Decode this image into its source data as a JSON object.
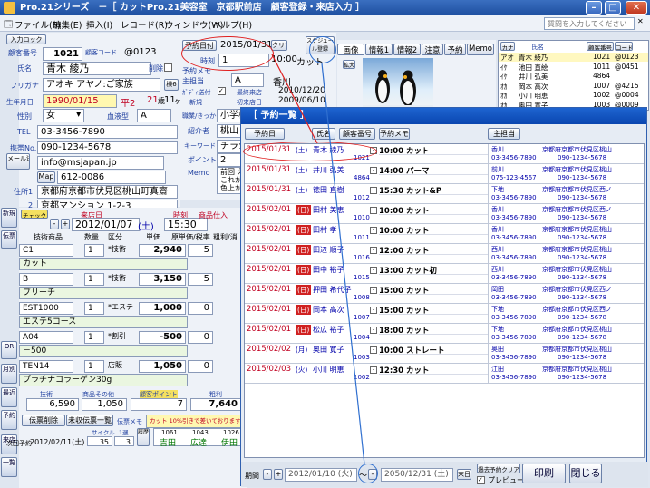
{
  "window": {
    "title": "Pro.21シリーズ　－［ カットPro.21美容室　京都駅前店　顧客登録・来店入力 ］"
  },
  "menu": {
    "items": [
      "ファイル(F)",
      "編集(E)",
      "挿入(I)",
      "レコード(R)",
      "ウィンドウ(W)",
      "ヘルプ(H)"
    ],
    "question_placeholder": "質問を入力してください"
  },
  "sidebar": {
    "buttons": [
      "新規",
      "伝票",
      "OR",
      "月別",
      "最近",
      "予約",
      "来店",
      "一覧"
    ]
  },
  "customer": {
    "intake_btn": "入力ロック",
    "no_label": "顧客番号",
    "no": "1021",
    "code_label": "顧客コード",
    "code": "@0123",
    "name_label": "氏名",
    "name": "青木 綾乃",
    "delete_label": "削除",
    "furigana_label": "フリガナ",
    "furigana": "アオキ アヤノ:ご家族",
    "suffix": "様6",
    "birth_label": "生年月日",
    "birth": "1990/01/15",
    "era": "平2",
    "age": "21",
    "age_unit": "歳",
    "month": "11",
    "month_unit": "ヶ月",
    "gender_label": "性別",
    "gender": "女",
    "blood_label": "血液型",
    "blood": "A",
    "tel_label": "TEL",
    "tel": "03-3456-7890",
    "mobile_label": "携帯No.",
    "mobile": "090-1234-5678",
    "mail_label": "メール送信",
    "mail": "info@msjapan.jp",
    "map_btn": "Map",
    "zip": "612-0086",
    "addr_label": "住所1",
    "addr1": "京都府京都市伏見区桃山町真齋",
    "addr2_label": "2",
    "addr2": "京都マンション 1-2-3"
  },
  "reserve": {
    "date_btn": "予約日付",
    "date": "2015/01/31",
    "clear": "クリア",
    "time_label": "時刻",
    "hour": "1",
    "min": "",
    "time": "10:00",
    "menu": "カット",
    "memo_label": "予約メモ",
    "staff_label": "主担当",
    "staff": "A",
    "staff_name": "香川",
    "send_label": "ｶﾞﾃﾞｨ送付",
    "first_label": "最終来店",
    "first": "2010/12/20",
    "new_label": "新規",
    "register_label": "初来店日",
    "register": "2009/06/10",
    "intro_label": "紹介者",
    "occupation_label": "職業/きっかけ",
    "occupation": "小学校",
    "store_label": "桃山",
    "keyword_label": "キーワード",
    "keyword": "チラシ",
    "point_label": "ポイント",
    "point": "2",
    "memo_label2": "Memo",
    "memo_text": "前回 え これが 色上が"
  },
  "tabs": [
    "画像",
    "情報1",
    "情報2",
    "注意",
    "予約",
    "Memo"
  ],
  "right_list": {
    "header": [
      "カナ",
      "氏名",
      "顧客番号",
      "コード"
    ],
    "rows": [
      {
        "k": "アオ",
        "n": "青木 綾乃",
        "no": "1021",
        "c": "@0123"
      },
      {
        "k": "ｲｹ",
        "n": "池田 直絵",
        "no": "1011",
        "c": "@0451"
      },
      {
        "k": "ｲｹ",
        "n": "井川 弘美",
        "no": "4864",
        "c": ""
      },
      {
        "k": "ｵｶ",
        "n": "岡本 高次",
        "no": "1007",
        "c": "@4215"
      },
      {
        "k": "ｵｶ",
        "n": "小川 明恵",
        "no": "1002",
        "c": "@0004"
      },
      {
        "k": "ｵｶ",
        "n": "奥田 寛子",
        "no": "1003",
        "c": "@0009"
      }
    ]
  },
  "visit": {
    "label": "来店日",
    "date": "2012/01/07",
    "dow": "(土)",
    "time_label": "時刻",
    "time": "15:30",
    "slip_label": "商品仕入",
    "cols": [
      "技術商品",
      "数量",
      "区分",
      "単価",
      "原単価/税率",
      "粗利/消"
    ],
    "rows": [
      {
        "code": "C1",
        "qty": "1",
        "kind": "*技術",
        "price": "2,940",
        "rate": "5",
        "name": "カット"
      },
      {
        "code": "B",
        "qty": "1",
        "kind": "*技術",
        "price": "3,150",
        "rate": "5",
        "name": "ブリーチ"
      },
      {
        "code": "EST1000",
        "qty": "1",
        "kind": "*エステ",
        "price": "1,000",
        "rate": "0",
        "name": "エステ5コース"
      },
      {
        "code": "A04",
        "qty": "1",
        "kind": "*割引",
        "price": "-500",
        "rate": "0",
        "name": "－500"
      },
      {
        "code": "TEN14",
        "qty": "1",
        "kind": "店販",
        "price": "1,050",
        "rate": "0",
        "name": "プラチナコラーゲン30g"
      }
    ],
    "sum_tech_label": "技術",
    "sum_tech": "6,590",
    "sum_goods_label": "商品その他",
    "sum_goods": "1,050",
    "sum_point_label": "顧客ポイント",
    "sum_point": "7",
    "sum_gross_label": "粗利",
    "sum_gross": "7,640",
    "slip_del": "伝票削除",
    "unpaid": "未収伝票一覧",
    "slip_memo": "伝票メモ",
    "slip_memo_text": "カット 10%引きで差いております",
    "next_label": "次回予約",
    "next": "2012/02/11(土)",
    "cycle": "サイクル",
    "cycle_val": "35",
    "week": "1週",
    "week_val": "3",
    "foot_staff": [
      "1061",
      "1043",
      "1026"
    ],
    "foot_names": [
      "吉田",
      "広達",
      "伊田"
    ],
    "history_label": "履歴"
  },
  "dialog": {
    "title": "［ 予約一覧 ］",
    "headers": [
      "予約日",
      "氏名",
      "顧客番号",
      "予約メモ",
      "主担当"
    ],
    "rows": [
      {
        "d": "2015/01/31",
        "w": "(土)",
        "red": false,
        "n": "青木 綾乃",
        "id": "1021",
        "t": "10:00 カット",
        "s": "香川",
        "ad": "京都府京都市伏見区桃山",
        "t1": "03-3456-7890",
        "t2": "090-1234-5678"
      },
      {
        "d": "2015/01/31",
        "w": "(土)",
        "red": false,
        "n": "井川 弘美",
        "id": "4864",
        "t": "14:00 パーマ",
        "s": "前川",
        "ad": "京都府京都市伏見区桃山",
        "t1": "075-123-4567",
        "t2": "090-1234-5678"
      },
      {
        "d": "2015/01/31",
        "w": "(土)",
        "red": false,
        "n": "徳田 直樹",
        "id": "1012",
        "t": "15:30 カット&P",
        "s": "下地",
        "ad": "京都府京都市伏見区西ノ",
        "t1": "03-3456-7890",
        "t2": "090-1234-5678"
      },
      {
        "d": "2015/02/01",
        "w": "(日)",
        "red": true,
        "n": "田村 美恵",
        "id": "1010",
        "t": "10:00 カット",
        "s": "香川",
        "ad": "京都府京都市伏見区西ノ",
        "t1": "03-3456-7890",
        "t2": "090-1234-5678"
      },
      {
        "d": "2015/02/01",
        "w": "(日)",
        "red": true,
        "n": "田村 孝",
        "id": "1011",
        "t": "10:00 カット",
        "s": "香川",
        "ad": "京都府京都市伏見区桃山",
        "t1": "03-3456-7890",
        "t2": "090-1234-5678"
      },
      {
        "d": "2015/02/01",
        "w": "(日)",
        "red": true,
        "n": "田辺 順子",
        "id": "1016",
        "t": "12:00 カット",
        "s": "西川",
        "ad": "京都府京都市伏見区桃山",
        "t1": "03-3456-7890",
        "t2": "090-1234-5678"
      },
      {
        "d": "2015/02/01",
        "w": "(日)",
        "red": true,
        "n": "田中 裕子",
        "id": "1015",
        "t": "13:00 カット初",
        "s": "西川",
        "ad": "京都府京都市伏見区桃山",
        "t1": "03-3456-7890",
        "t2": "090-1234-5678"
      },
      {
        "d": "2015/02/01",
        "w": "(日)",
        "red": true,
        "n": "押田 希代子",
        "id": "1008",
        "t": "15:00 カット",
        "s": "岡田",
        "ad": "京都府京都市伏見区西ノ",
        "t1": "03-3456-7890",
        "t2": "090-1234-5678"
      },
      {
        "d": "2015/02/01",
        "w": "(日)",
        "red": true,
        "n": "岡本 高次",
        "id": "1007",
        "t": "15:00 カット",
        "s": "下地",
        "ad": "京都府京都市伏見区西ノ",
        "t1": "03-3456-7890",
        "t2": "090-1234-5678"
      },
      {
        "d": "2015/02/01",
        "w": "(日)",
        "red": true,
        "n": "松広 裕子",
        "id": "1004",
        "t": "18:00 カット",
        "s": "下地",
        "ad": "京都府京都市伏見区桃山",
        "t1": "03-3456-7890",
        "t2": "090-1234-5678"
      },
      {
        "d": "2015/02/02",
        "w": "(月)",
        "red": false,
        "n": "奥田 寛子",
        "id": "1003",
        "t": "10:00 ストレート",
        "s": "奥田",
        "ad": "京都府京都市伏見区桃山",
        "t1": "03-3456-7890",
        "t2": "090-1234-5678"
      },
      {
        "d": "2015/02/03",
        "w": "(火)",
        "red": false,
        "n": "小川 明恵",
        "id": "1002",
        "t": "12:30 カット",
        "s": "江田",
        "ad": "京都府京都市伏見区桃山",
        "t1": "03-3456-7890",
        "t2": "090-1234-5678"
      }
    ],
    "period_label": "期間",
    "from": "2012/01/10 (火)",
    "tilde": "～",
    "to": "2050/12/31 (土)",
    "end_label": "末日",
    "clear_label": "過去予約クリア",
    "preview_label": "プレビュー",
    "print": "印刷",
    "close": "閉じる"
  }
}
